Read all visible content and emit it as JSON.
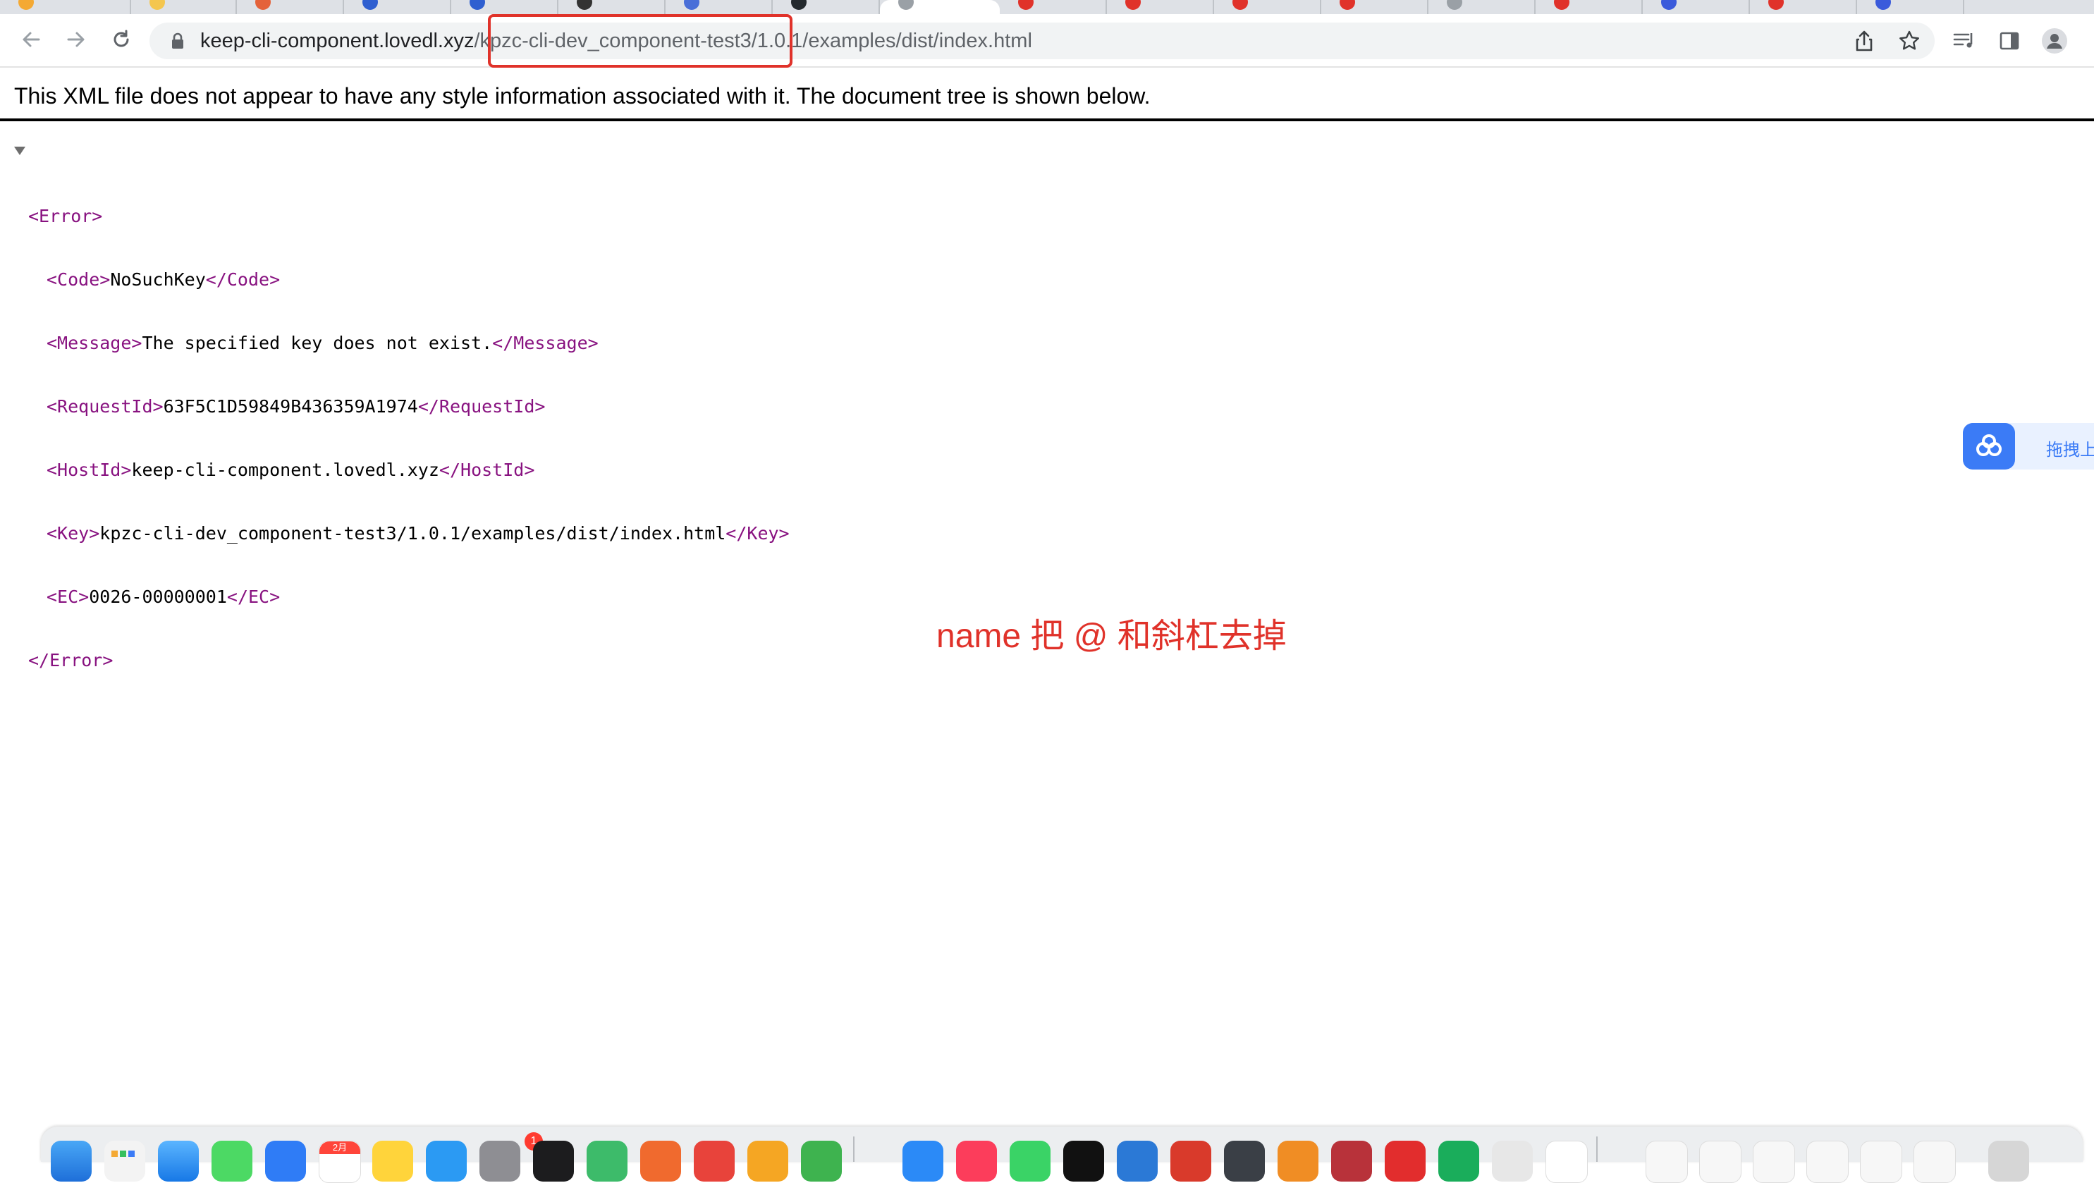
{
  "browser": {
    "address_bar": {
      "host": "keep-cli-component.lovedl.xyz",
      "path": "/kpzc-cli-dev_component-test3/1.0.1/examples/dist/index.html"
    }
  },
  "xml_viewer": {
    "header": "This XML file does not appear to have any style information associated with it. The document tree is shown below.",
    "root_open": "<Error>",
    "root_close": "</Error>",
    "nodes": [
      {
        "open": "<Code>",
        "value": "NoSuchKey",
        "close": "</Code>"
      },
      {
        "open": "<Message>",
        "value": "The specified key does not exist.",
        "close": "</Message>"
      },
      {
        "open": "<RequestId>",
        "value": "63F5C1D59849B436359A1974",
        "close": "</RequestId>"
      },
      {
        "open": "<HostId>",
        "value": "keep-cli-component.lovedl.xyz",
        "close": "</HostId>"
      },
      {
        "open": "<Key>",
        "value": "kpzc-cli-dev_component-test3/1.0.1/examples/dist/index.html",
        "close": "</Key>"
      },
      {
        "open": "<EC>",
        "value": "0026-00000001",
        "close": "</EC>"
      }
    ]
  },
  "annotation": {
    "note": "name 把 @ 和斜杠去掉",
    "color": "#e0322a"
  },
  "baidu_widget": {
    "label": "拖拽上"
  },
  "dock": {
    "calendar_month": "2月",
    "badge_count": "1"
  },
  "colors": {
    "tag": "#881280",
    "accent_blue": "#3b7bf6"
  }
}
